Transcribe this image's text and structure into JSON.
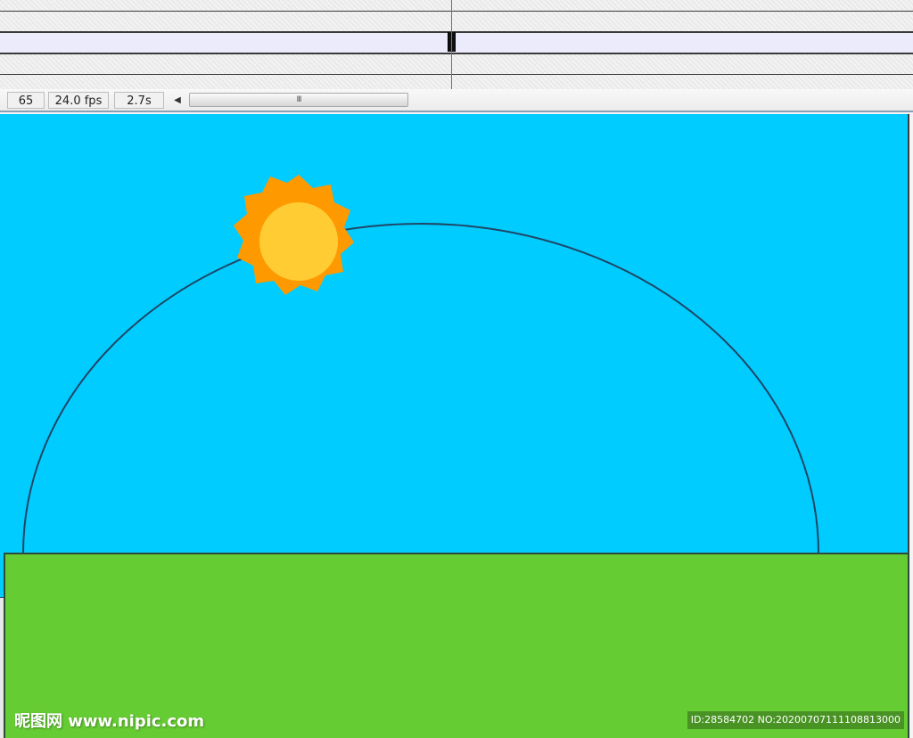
{
  "timeline": {
    "layers": [
      {
        "state": "normal"
      },
      {
        "state": "active"
      },
      {
        "state": "normal"
      }
    ]
  },
  "status": {
    "current_frame": "65",
    "frame_rate": "24.0 fps",
    "elapsed_time": "2.7s",
    "scroll_grip": "III"
  },
  "stage": {
    "sky_color": "#00ccff",
    "ground_color": "#66cc33",
    "sun_outer_color": "#ff9900",
    "sun_inner_color": "#ffcc33",
    "path_color": "#1f4666"
  },
  "watermark": {
    "left": "昵图网 www.nipic.com",
    "right": "ID:28584702 NO:20200707111108813000"
  }
}
